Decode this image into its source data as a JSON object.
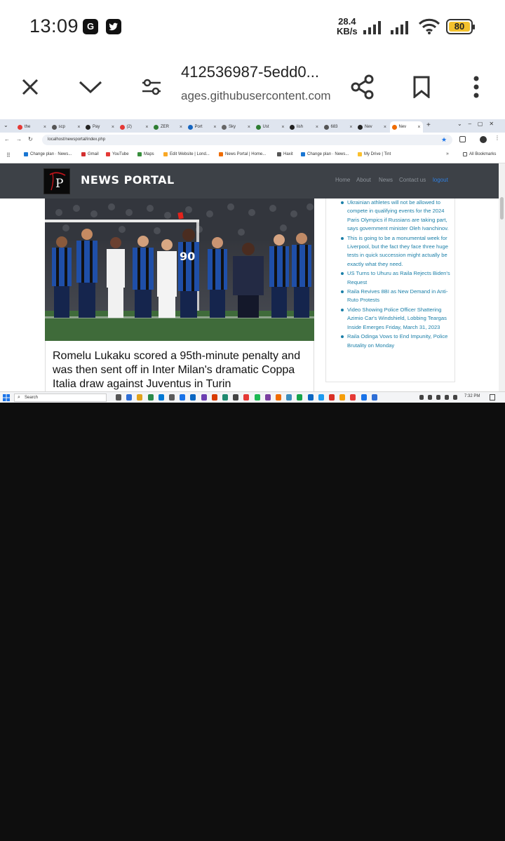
{
  "status_bar": {
    "time": "13:09",
    "app_icons": [
      "G",
      "bird"
    ],
    "net_speed_value": "28.4",
    "net_speed_unit": "KB/s",
    "battery": "80"
  },
  "mobile_browser": {
    "page_title": "412536987-5edd0...",
    "host": "ages.githubusercontent.com",
    "icons": [
      "close-icon",
      "chevron-down-icon",
      "page-settings-icon",
      "share-icon",
      "bookmark-icon",
      "more-icon"
    ]
  },
  "desktop": {
    "tabs": [
      {
        "label": "the",
        "color": "#e53935"
      },
      {
        "label": "scp",
        "color": "#555555"
      },
      {
        "label": "Pay",
        "color": "#222222"
      },
      {
        "label": "(2)",
        "color": "#e53935"
      },
      {
        "label": "ZER",
        "color": "#2e7d32"
      },
      {
        "label": "Port",
        "color": "#1565c0"
      },
      {
        "label": "Sky",
        "color": "#666666"
      },
      {
        "label": "Ust",
        "color": "#2e7d32"
      },
      {
        "label": "lish",
        "color": "#222222"
      },
      {
        "label": "683",
        "color": "#555555"
      },
      {
        "label": "Nev",
        "color": "#222222"
      },
      {
        "label": "Nev",
        "color": "#ef6c00"
      }
    ],
    "address": "localhost/newsportal/index.php",
    "bookmarks": [
      {
        "label": "Change plan · News...",
        "color": "#1976d2"
      },
      {
        "label": "Gmail",
        "color": "#d32f2f"
      },
      {
        "label": "YouTube",
        "color": "#e53935"
      },
      {
        "label": "Maps",
        "color": "#388e3c"
      },
      {
        "label": "Edit Website | Lond...",
        "color": "#f9a825"
      },
      {
        "label": "News Portal | Home...",
        "color": "#ef6c00"
      },
      {
        "label": "Haxit",
        "color": "#555555"
      },
      {
        "label": "Change plan · News...",
        "color": "#1976d2"
      },
      {
        "label": "My Drive | Tint",
        "color": "#fbc02d"
      }
    ],
    "all_bookmarks": "All Bookmarks",
    "site": {
      "brand": "NEWS PORTAL",
      "nav": [
        "Home",
        "About",
        "News",
        "Contact us",
        "logout"
      ]
    },
    "article": {
      "headline": "Romelu Lukaku scored a 95th-minute penalty and was then sent off in Inter Milan's dramatic Coppa Italia draw against Juventus in Turin"
    },
    "sidebar_links": [
      "Ukrainian athletes will not be allowed to compete in qualifying events for the 2024 Paris Olympics if Russians are taking part, says government minister Oleh Ivanchinov.",
      "This is going to be a monumental week for Liverpool, but the fact they face three huge tests in quick succession might actually be exactly what they need.",
      "US Turns to Uhuru as Raila Rejects Biden's Request",
      "Raila Revives 8BI as New Demand in Anti-Ruto Protests",
      "Video Showing Police Officer Shattering Azimio Car's Windshield, Lobbing Teargas Inside Emerges Friday, March 31, 2023",
      "Raila Odinga Vows to End Impunity, Police Brutality on Monday"
    ],
    "taskbar": {
      "search": "Search",
      "time": "7:32 PM"
    }
  }
}
